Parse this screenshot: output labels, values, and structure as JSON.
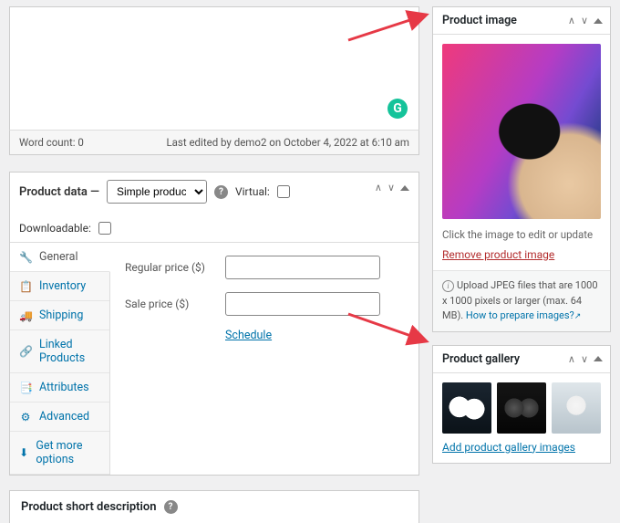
{
  "editor": {
    "word_count": "Word count: 0",
    "last_edited": "Last edited by demo2 on October 4, 2022 at 6:10 am"
  },
  "product_data": {
    "title": "Product data —",
    "type_selected": "Simple product",
    "virtual_label": "Virtual:",
    "downloadable_label": "Downloadable:",
    "tabs": [
      {
        "icon": "General",
        "label": "General"
      },
      {
        "icon": "Inventory",
        "label": "Inventory"
      },
      {
        "icon": "Shipping",
        "label": "Shipping"
      },
      {
        "icon": "Linked",
        "label": "Linked Products"
      },
      {
        "icon": "Attributes",
        "label": "Attributes"
      },
      {
        "icon": "Advanced",
        "label": "Advanced"
      },
      {
        "icon": "More",
        "label": "Get more options"
      }
    ],
    "fields": {
      "regular_price_label": "Regular price ($)",
      "sale_price_label": "Sale price ($)",
      "schedule_label": "Schedule"
    }
  },
  "short_desc": {
    "title": "Product short description"
  },
  "product_image": {
    "title": "Product image",
    "hint": "Click the image to edit or update",
    "remove": "Remove product image",
    "upload_hint_pre": "Upload JPEG files that are 1000 x 1000 pixels or larger (max. 64 MB). ",
    "upload_hint_link": "How to prepare images?"
  },
  "product_gallery": {
    "title": "Product gallery",
    "add_link": "Add product gallery images"
  }
}
